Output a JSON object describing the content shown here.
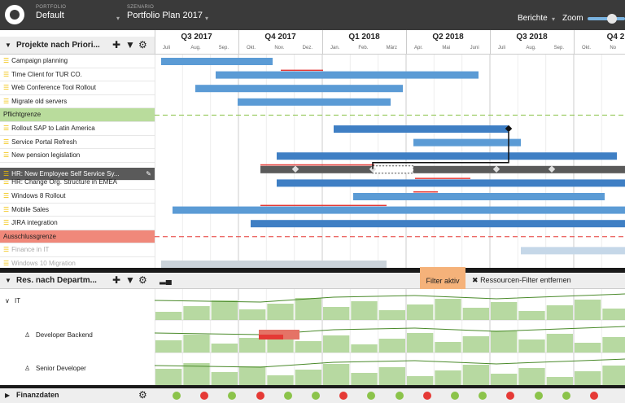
{
  "portfolio": {
    "label": "PORTFOLIO",
    "value": "Default"
  },
  "scenario": {
    "label": "SZENARIO",
    "value": "Portfolio Plan 2017"
  },
  "berichte": "Berichte",
  "zoom": "Zoom",
  "projects_panel": {
    "title": "Projekte nach Priori..."
  },
  "quarters": [
    "Q3 2017",
    "Q4 2017",
    "Q1 2018",
    "Q2 2018",
    "Q3 2018",
    "Q4 2"
  ],
  "months": [
    "Juli",
    "Aug.",
    "Sep.",
    "Okt.",
    "Nov.",
    "Dez.",
    "Jan.",
    "Feb.",
    "März",
    "Apr.",
    "Mai",
    "Juni",
    "Juli",
    "Aug.",
    "Sep.",
    "Okt.",
    "No"
  ],
  "projects": [
    {
      "label": "Campaign planning",
      "type": "normal"
    },
    {
      "label": "Time Client for TUR CO.",
      "type": "normal"
    },
    {
      "label": "Web Conference Tool Rollout",
      "type": "normal"
    },
    {
      "label": "Migrate old servers",
      "type": "normal"
    },
    {
      "label": "Pflichtgrenze",
      "type": "green"
    },
    {
      "label": "Rollout SAP to Latin America",
      "type": "normal"
    },
    {
      "label": "Service Portal Refresh",
      "type": "normal"
    },
    {
      "label": "New pension legislation",
      "type": "normal"
    },
    {
      "label": "HR: New Employee Self Service Sy...",
      "type": "sel"
    },
    {
      "label": "HR: Change Org. Structure in EMEA",
      "type": "normal"
    },
    {
      "label": "Windows 8 Rollout",
      "type": "normal"
    },
    {
      "label": "Mobile Sales",
      "type": "normal"
    },
    {
      "label": "JIRA integration",
      "type": "normal"
    },
    {
      "label": "Ausschlussgrenze",
      "type": "red"
    },
    {
      "label": "Finance in IT",
      "type": "faded"
    },
    {
      "label": "Windows 10 Migration",
      "type": "faded"
    }
  ],
  "resources_panel": {
    "title": "Res. nach Departm..."
  },
  "filter_active": "Filter aktiv",
  "resource_filter_remove": "Ressourcen-Filter entfernen",
  "resources": [
    {
      "label": "IT",
      "icon": "chevron-down-icon"
    },
    {
      "label": "Developer Backend",
      "icon": "user-icon"
    },
    {
      "label": "Senior Developer",
      "icon": "user-icon"
    }
  ],
  "finanzdaten": "Finanzdaten",
  "finance_dots": [
    "green",
    "red",
    "green",
    "red",
    "green",
    "green",
    "red",
    "green",
    "green",
    "red",
    "green",
    "green",
    "red",
    "green",
    "green",
    "red"
  ],
  "colors": {
    "bar": "#5b9bd5",
    "bar_dark": "#3f7fc4",
    "selected": "#5a5a5a",
    "green": "#8bc34a",
    "red": "#e53935"
  }
}
